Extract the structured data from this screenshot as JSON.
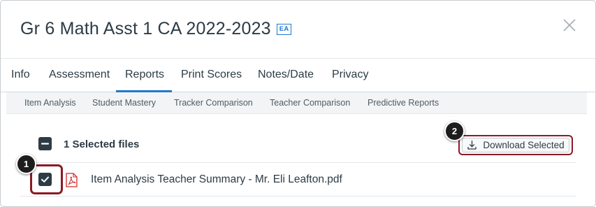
{
  "header": {
    "title": "Gr 6 Math Asst 1 CA 2022-2023",
    "badge": "EA"
  },
  "tabs": [
    {
      "label": "Info"
    },
    {
      "label": "Assessment"
    },
    {
      "label": "Reports",
      "active": true
    },
    {
      "label": "Print Scores"
    },
    {
      "label": "Notes/Date"
    },
    {
      "label": "Privacy"
    }
  ],
  "subtabs": [
    {
      "label": "Item Analysis"
    },
    {
      "label": "Student Mastery"
    },
    {
      "label": "Tracker Comparison"
    },
    {
      "label": "Teacher Comparison"
    },
    {
      "label": "Predictive Reports"
    }
  ],
  "selection": {
    "label": "1 Selected files",
    "download_label": "Download Selected"
  },
  "files": [
    {
      "name": "Item Analysis Teacher Summary - Mr. Eli Leafton.pdf",
      "checked": true
    }
  ],
  "callouts": [
    "1",
    "2"
  ],
  "colors": {
    "accent": "#1f78d1",
    "highlight": "#8a1b24",
    "pdf_icon": "#d02b2b",
    "text": "#2d3b45"
  }
}
